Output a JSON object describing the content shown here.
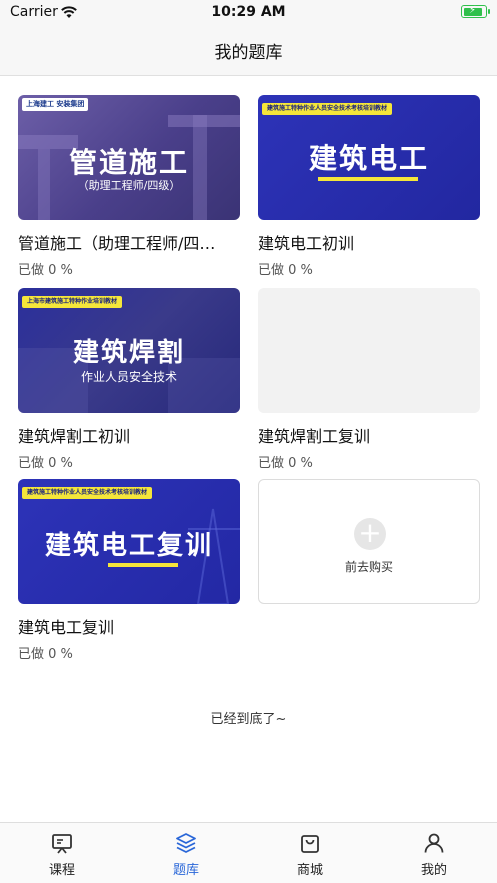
{
  "status_bar": {
    "carrier": "Carrier",
    "time": "10:29 AM",
    "battery_level": 0.9
  },
  "nav": {
    "title": "我的题库"
  },
  "courses": [
    {
      "title": "管道施工（助理工程师/四…",
      "progress": "已做 0 %",
      "banner": {
        "logo": "上海建工  安装集团",
        "main": "管道施工",
        "sub": "（助理工程师/四级）"
      }
    },
    {
      "title": "建筑电工初训",
      "progress": "已做 0 %",
      "banner": {
        "tag": "建筑施工特种作业人员安全技术考核培训教材",
        "main": "建筑电工"
      }
    },
    {
      "title": "建筑焊割工初训",
      "progress": "已做 0 %",
      "banner": {
        "tag": "上海市建筑施工特种作业培训教材",
        "main": "建筑焊割",
        "sub": "作业人员安全技术"
      }
    },
    {
      "title": "建筑焊割工复训",
      "progress": "已做 0 %"
    },
    {
      "title": "建筑电工复训",
      "progress": "已做 0 %",
      "banner": {
        "tag": "建筑施工特种作业人员安全技术考核培训教材",
        "main": "建筑电工复训"
      }
    }
  ],
  "buy_card": {
    "label": "前去购买",
    "icon": "plus-icon"
  },
  "end_text": "已经到底了~",
  "tabs": [
    {
      "label": "课程",
      "icon": "course-board-icon",
      "active": false
    },
    {
      "label": "题库",
      "icon": "layers-icon",
      "active": true
    },
    {
      "label": "商城",
      "icon": "shopping-bag-icon",
      "active": false
    },
    {
      "label": "我的",
      "icon": "person-icon",
      "active": false
    }
  ],
  "colors": {
    "accent": "#2a67d8",
    "banner_blue": "#2a2fa8",
    "banner_purple": "#5a4a9a",
    "tag_yellow": "#f5e63a"
  }
}
